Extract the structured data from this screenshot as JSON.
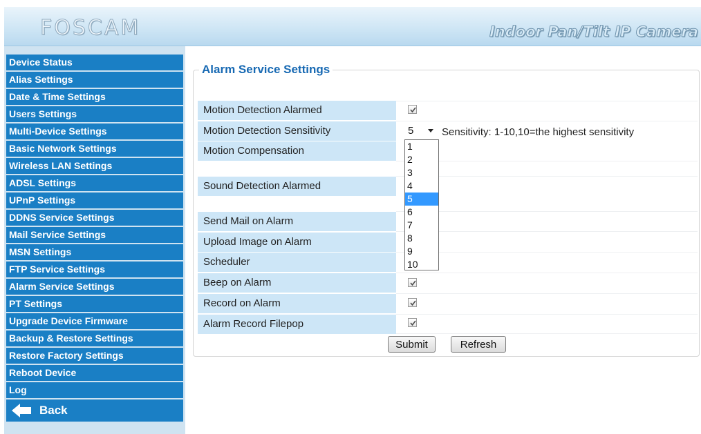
{
  "header": {
    "logo": "FOSCAM",
    "tagline": "Indoor Pan/Tilt IP Camera"
  },
  "sidebar": {
    "items": [
      {
        "label": "Device Status"
      },
      {
        "label": "Alias Settings"
      },
      {
        "label": "Date & Time Settings"
      },
      {
        "label": "Users Settings"
      },
      {
        "label": "Multi-Device Settings"
      },
      {
        "label": "Basic Network Settings"
      },
      {
        "label": "Wireless LAN Settings"
      },
      {
        "label": "ADSL Settings"
      },
      {
        "label": "UPnP Settings"
      },
      {
        "label": "DDNS Service Settings"
      },
      {
        "label": "Mail Service Settings"
      },
      {
        "label": "MSN Settings"
      },
      {
        "label": "FTP Service Settings"
      },
      {
        "label": "Alarm Service Settings"
      },
      {
        "label": "PT Settings"
      },
      {
        "label": "Upgrade Device Firmware"
      },
      {
        "label": "Backup & Restore Settings"
      },
      {
        "label": "Restore Factory Settings"
      },
      {
        "label": "Reboot Device"
      },
      {
        "label": "Log"
      }
    ],
    "back_label": "Back",
    "back_icon": "left-arrow-icon"
  },
  "main": {
    "title": "Alarm Service Settings",
    "rows": {
      "motion_alarmed": {
        "label": "Motion Detection Alarmed",
        "checked": true
      },
      "motion_sensitivity": {
        "label": "Motion Detection Sensitivity"
      },
      "motion_compensation": {
        "label": "Motion Compensation"
      },
      "sound_alarmed": {
        "label": "Sound Detection Alarmed"
      },
      "send_mail": {
        "label": "Send Mail on Alarm"
      },
      "upload_image": {
        "label": "Upload Image on Alarm"
      },
      "scheduler": {
        "label": "Scheduler"
      },
      "beep": {
        "label": "Beep on Alarm",
        "checked": true
      },
      "record": {
        "label": "Record on Alarm",
        "checked": true
      },
      "record_filepop": {
        "label": "Alarm Record Filepop",
        "checked": true
      }
    },
    "sensitivity": {
      "value": "5",
      "hint": "Sensitivity: 1-10,10=the highest sensitivity",
      "options": [
        "1",
        "2",
        "3",
        "4",
        "5",
        "6",
        "7",
        "8",
        "9",
        "10"
      ],
      "selected_index": 4
    },
    "buttons": {
      "submit": "Submit",
      "refresh": "Refresh"
    }
  },
  "colors": {
    "nav_background": "#1a7fc5",
    "label_background": "#cde6f7",
    "title_color": "#1769b3",
    "option_highlight": "#3399ff"
  }
}
